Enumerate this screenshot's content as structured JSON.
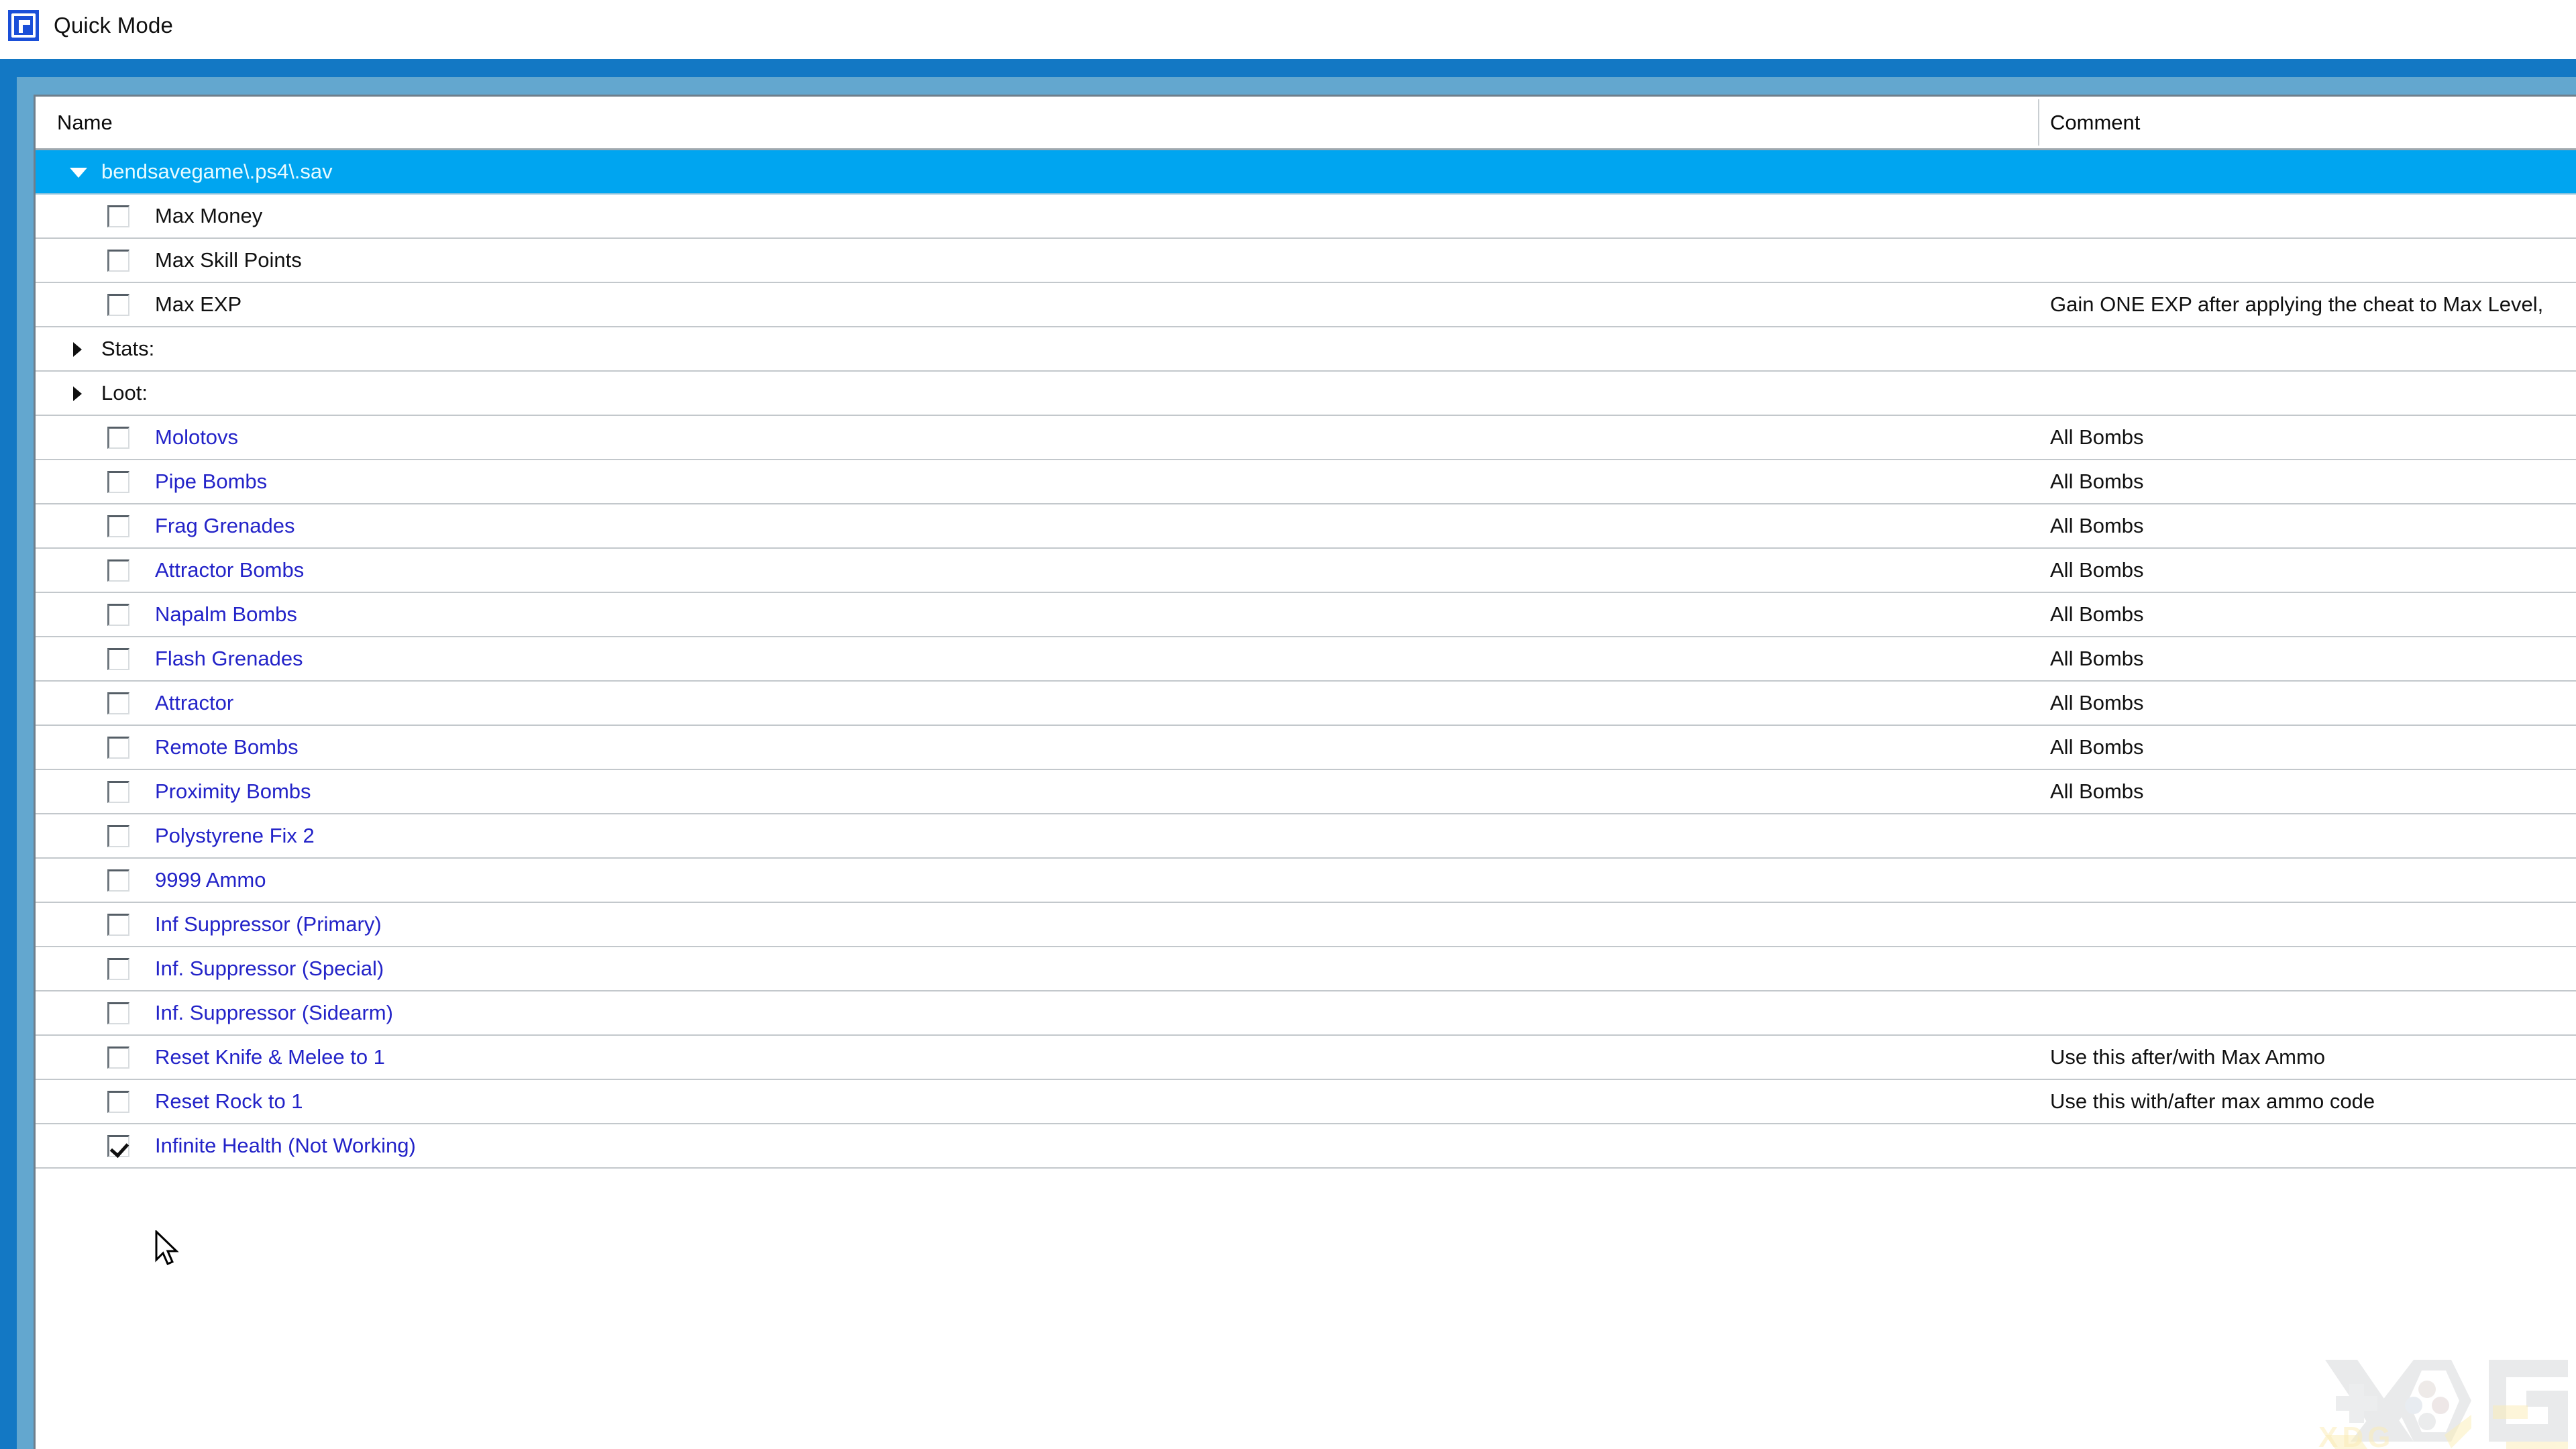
{
  "window": {
    "title": "Quick Mode",
    "icon": "app-ps4-save-editor-icon"
  },
  "colors": {
    "frame_outer": "#1378c4",
    "frame_inner": "#63a7cf",
    "selection": "#00a5f0",
    "link_text": "#2323c8",
    "grid_line": "#c3c8cc",
    "panel_bg": "#ffffff"
  },
  "tree": {
    "columns": [
      {
        "key": "name",
        "label": "Name"
      },
      {
        "key": "comment",
        "label": "Comment"
      }
    ],
    "rows": [
      {
        "name": "bendsavegame\\.ps4\\.sav",
        "comment": "",
        "type": "root",
        "expanded": true,
        "selected": true,
        "checkbox": false,
        "style": "selected"
      },
      {
        "name": "Max Money",
        "comment": "",
        "type": "item",
        "checkbox": true,
        "checked": false,
        "style": "normal"
      },
      {
        "name": "Max Skill Points",
        "comment": "",
        "type": "item",
        "checkbox": true,
        "checked": false,
        "style": "normal"
      },
      {
        "name": "Max EXP",
        "comment": "Gain ONE EXP after applying the cheat to Max Level,",
        "type": "item",
        "checkbox": true,
        "checked": false,
        "style": "normal"
      },
      {
        "name": "Stats:",
        "comment": "",
        "type": "group",
        "expanded": false,
        "checkbox": false,
        "style": "normal"
      },
      {
        "name": "Loot:",
        "comment": "",
        "type": "group",
        "expanded": false,
        "checkbox": false,
        "style": "normal"
      },
      {
        "name": "Molotovs",
        "comment": "All Bombs",
        "type": "item",
        "checkbox": true,
        "checked": false,
        "style": "link"
      },
      {
        "name": "Pipe Bombs",
        "comment": "All Bombs",
        "type": "item",
        "checkbox": true,
        "checked": false,
        "style": "link"
      },
      {
        "name": "Frag Grenades",
        "comment": "All Bombs",
        "type": "item",
        "checkbox": true,
        "checked": false,
        "style": "link"
      },
      {
        "name": "Attractor Bombs",
        "comment": "All Bombs",
        "type": "item",
        "checkbox": true,
        "checked": false,
        "style": "link"
      },
      {
        "name": "Napalm Bombs",
        "comment": "All Bombs",
        "type": "item",
        "checkbox": true,
        "checked": false,
        "style": "link"
      },
      {
        "name": "Flash Grenades",
        "comment": "All Bombs",
        "type": "item",
        "checkbox": true,
        "checked": false,
        "style": "link"
      },
      {
        "name": "Attractor",
        "comment": "All Bombs",
        "type": "item",
        "checkbox": true,
        "checked": false,
        "style": "link"
      },
      {
        "name": "Remote Bombs",
        "comment": "All Bombs",
        "type": "item",
        "checkbox": true,
        "checked": false,
        "style": "link"
      },
      {
        "name": "Proximity Bombs",
        "comment": "All Bombs",
        "type": "item",
        "checkbox": true,
        "checked": false,
        "style": "link"
      },
      {
        "name": "Polystyrene Fix 2",
        "comment": "",
        "type": "item",
        "checkbox": true,
        "checked": false,
        "style": "link"
      },
      {
        "name": "9999 Ammo",
        "comment": "",
        "type": "item",
        "checkbox": true,
        "checked": false,
        "style": "link"
      },
      {
        "name": "Inf Suppressor (Primary)",
        "comment": "",
        "type": "item",
        "checkbox": true,
        "checked": false,
        "style": "link"
      },
      {
        "name": "Inf. Suppressor (Special)",
        "comment": "",
        "type": "item",
        "checkbox": true,
        "checked": false,
        "style": "link"
      },
      {
        "name": "Inf. Suppressor (Sidearm)",
        "comment": "",
        "type": "item",
        "checkbox": true,
        "checked": false,
        "style": "link"
      },
      {
        "name": "Reset Knife & Melee to 1",
        "comment": "Use this after/with Max Ammo",
        "type": "item",
        "checkbox": true,
        "checked": false,
        "style": "link"
      },
      {
        "name": "Reset Rock to 1",
        "comment": "Use this with/after max ammo code",
        "type": "item",
        "checkbox": true,
        "checked": false,
        "style": "link"
      },
      {
        "name": "Infinite Health (Not Working)",
        "comment": "",
        "type": "item",
        "checkbox": true,
        "checked": true,
        "style": "link"
      }
    ]
  },
  "watermark": {
    "text": "XDG"
  }
}
